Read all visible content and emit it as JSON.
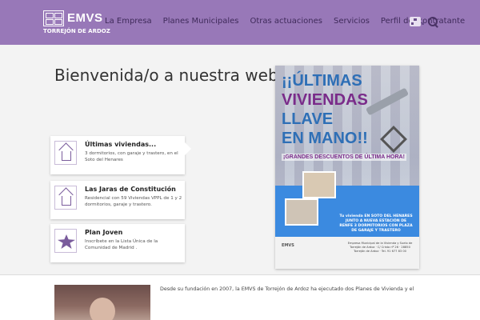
{
  "header": {
    "brand": "EMVS",
    "subtitle": "TORREJÓN DE ARDOZ",
    "nav": [
      {
        "label": "La Empresa"
      },
      {
        "label": "Planes Municipales"
      },
      {
        "label": "Otras actuaciones"
      },
      {
        "label": "Servicios"
      },
      {
        "label": "Perfil del contratante"
      }
    ],
    "tools": {
      "sitemap_icon": "sitemap-icon",
      "search_icon": "search-icon"
    },
    "color": "#9878b8"
  },
  "hero": {
    "title": "Bienvenida/o a nuestra web",
    "cards": [
      {
        "title": "Últimas viviendas...",
        "text": "3 dormitorios, con garaje y trastero, en el Soto del Henares",
        "icon": "house-icon"
      },
      {
        "title": "Las Jaras de Constitución",
        "text": "Residencial con 59 Viviendas VPPL de 1 y 2 dormitorios, garaje y trastero.",
        "icon": "house-icon"
      },
      {
        "title": "Plan Joven",
        "text": "Inscríbete en la Lista Única de la Comunidad de Madrid .",
        "icon": "plan-joven-icon"
      }
    ]
  },
  "poster": {
    "line1": "¡¡ÚLTIMAS",
    "line2": "VIVIENDAS",
    "line3": "LLAVE",
    "line4": "EN MANO!!",
    "line5": "¡GRANDES DESCUENTOS DE ÚLTIMA HORA!",
    "blurb": "Tu vivienda EN SOTO DEL HENARES JUNTO A NUEVA ESTACIÓN DE RENFE 3 DORMITORIOS CON PLAZA DE GARAJE Y TRASTERO",
    "footer_logo": "EMVS",
    "footer_text": "Empresa Municipal de la Vivienda y Suelo de Torrejón de Ardoz · C/ Cristo nº 26 · 28850 Torrejón de Ardoz · Tel. 91 677 83 00"
  },
  "intro": {
    "text": "Desde su fundación en 2007, la EMVS de Torrejón de Ardoz ha ejecutado dos Planes de Vivienda y el"
  }
}
